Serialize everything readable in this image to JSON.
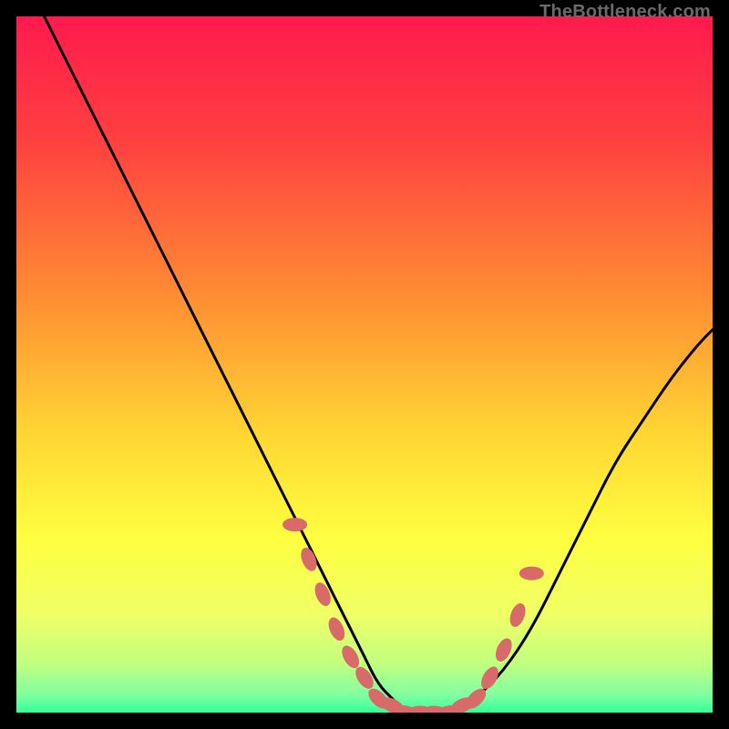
{
  "watermark": "TheBottleneck.com",
  "colors": {
    "frame": "#000000",
    "curve": "#000000",
    "marker_fill": "#d86a6a",
    "marker_stroke": "#d86a6a",
    "gradient_stops": [
      {
        "offset": 0,
        "color": "#ff1a4d"
      },
      {
        "offset": 0.18,
        "color": "#ff4040"
      },
      {
        "offset": 0.4,
        "color": "#ff8c33"
      },
      {
        "offset": 0.6,
        "color": "#ffd633"
      },
      {
        "offset": 0.75,
        "color": "#ffff40"
      },
      {
        "offset": 0.86,
        "color": "#f0ff66"
      },
      {
        "offset": 0.93,
        "color": "#c0ff80"
      },
      {
        "offset": 0.975,
        "color": "#80ffa0"
      },
      {
        "offset": 1.0,
        "color": "#33ff99"
      }
    ]
  },
  "chart_data": {
    "type": "line",
    "title": "",
    "xlabel": "",
    "ylabel": "",
    "xlim": [
      0,
      100
    ],
    "ylim": [
      0,
      100
    ],
    "series": [
      {
        "name": "bottleneck-curve",
        "x": [
          4,
          8,
          12,
          16,
          20,
          24,
          28,
          32,
          36,
          40,
          44,
          48,
          50,
          52,
          54,
          56,
          58,
          62,
          66,
          70,
          74,
          78,
          82,
          86,
          90,
          94,
          98,
          100
        ],
        "y": [
          100,
          92,
          84,
          76,
          68,
          60,
          52,
          44,
          36,
          28,
          20,
          12,
          8,
          4,
          2,
          0,
          0,
          0,
          2,
          6,
          12,
          20,
          28,
          36,
          42,
          48,
          53,
          55
        ]
      }
    ],
    "markers": {
      "name": "highlight-points",
      "x": [
        40,
        42,
        44,
        46,
        48,
        50,
        52,
        54,
        56,
        58,
        60,
        62,
        64,
        66,
        68,
        70,
        72,
        74
      ],
      "y": [
        27,
        22,
        17,
        12,
        8,
        5,
        2,
        1,
        0,
        0,
        0,
        0,
        1,
        2,
        5,
        9,
        14,
        20
      ]
    }
  }
}
